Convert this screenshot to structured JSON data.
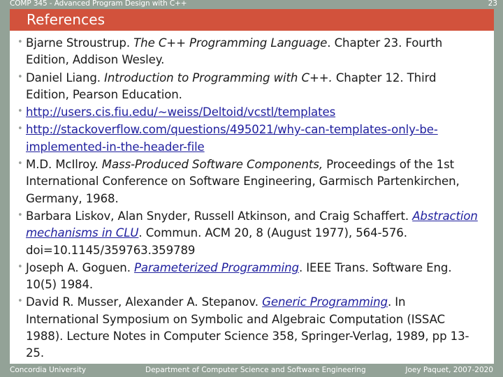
{
  "header": {
    "course_title": "COMP 345 - Advanced Program Design with C++",
    "page_number": "23",
    "slide_title": "References",
    "banner_color": "#d2523c",
    "bar_color": "#93a297"
  },
  "references": [
    {
      "id": "stroustrup",
      "parts": [
        {
          "type": "text",
          "value": "Bjarne Stroustrup. "
        },
        {
          "type": "italic",
          "value": "The C++ Programming Language"
        },
        {
          "type": "text",
          "value": ". Chapter 23. Fourth Edition, Addison Wesley."
        }
      ]
    },
    {
      "id": "liang",
      "parts": [
        {
          "type": "text",
          "value": "Daniel Liang. "
        },
        {
          "type": "italic",
          "value": "Introduction to Programming with C++."
        },
        {
          "type": "text",
          "value": " Chapter 12. Third Edition, Pearson Education."
        }
      ]
    },
    {
      "id": "fiu-templates-link",
      "parts": [
        {
          "type": "link",
          "value": "http://users.cis.fiu.edu/~weiss/Deltoid/vcstl/templates"
        }
      ]
    },
    {
      "id": "stackoverflow-link",
      "parts": [
        {
          "type": "link",
          "value": "http://stackoverflow.com/questions/495021/why-can-templates-only-be-implemented-in-the-header-file"
        }
      ]
    },
    {
      "id": "mcilroy",
      "parts": [
        {
          "type": "text",
          "value": "M.D. McIlroy. "
        },
        {
          "type": "italic",
          "value": "Mass-Produced Software Components,"
        },
        {
          "type": "text",
          "value": " Proceedings of the 1st International Conference on Software Engineering, Garmisch Partenkirchen, Germany, 1968."
        }
      ]
    },
    {
      "id": "liskov",
      "parts": [
        {
          "type": "text",
          "value": "Barbara Liskov, Alan Snyder, Russell Atkinson, and Craig Schaffert. "
        },
        {
          "type": "link-italic",
          "value": "Abstraction mechanisms in CLU"
        },
        {
          "type": "text",
          "value": ". Commun. ACM 20, 8 (August 1977), 564-576. doi=10.1145/359763.359789"
        }
      ]
    },
    {
      "id": "goguen",
      "parts": [
        {
          "type": "text",
          "value": "Joseph A. Goguen. "
        },
        {
          "type": "link-italic",
          "value": "Parameterized Programming"
        },
        {
          "type": "text",
          "value": ". IEEE Trans. Software Eng. 10(5) 1984."
        }
      ]
    },
    {
      "id": "musser-stepanov",
      "parts": [
        {
          "type": "text",
          "value": "David R. Musser, Alexander A. Stepanov. "
        },
        {
          "type": "link-italic",
          "value": "Generic Programming"
        },
        {
          "type": "text",
          "value": ". In International Symposium on Symbolic and Algebraic Computation (ISSAC 1988). Lecture Notes in Computer Science 358, Springer-Verlag, 1989, pp 13-25."
        }
      ]
    }
  ],
  "footer": {
    "left": "Concordia University",
    "center": "Department of Computer Science and Software Engineering",
    "right": "Joey Paquet, 2007-2020"
  }
}
